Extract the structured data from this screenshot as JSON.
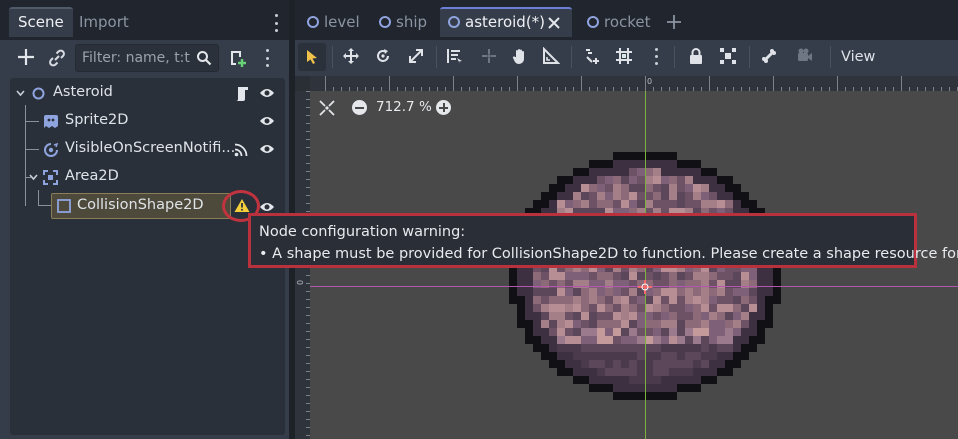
{
  "scene_dock": {
    "tabs": [
      "Scene",
      "Import"
    ],
    "filter_placeholder": "Filter: name, t:ty",
    "tree": [
      {
        "label": "Asteroid"
      },
      {
        "label": "Sprite2D"
      },
      {
        "label": "VisibleOnScreenNotifi..."
      },
      {
        "label": "Area2D"
      },
      {
        "label": "CollisionShape2D"
      }
    ]
  },
  "scene_tabs": [
    {
      "label": "level"
    },
    {
      "label": "ship"
    },
    {
      "label": "asteroid(*)"
    },
    {
      "label": "rocket"
    }
  ],
  "toolbar": {
    "view_label": "View"
  },
  "viewport": {
    "zoom_label": "712.7 %",
    "ruler_top_label": "0",
    "ruler_left_label": "0"
  },
  "warning": {
    "title": "Node configuration warning:",
    "message": "•  A shape must be provided for CollisionShape2D to function. Please create a shape resource for it!"
  },
  "colors": {
    "accent": "#6b7fd6",
    "warning_border": "#b8313c",
    "node_blue": "#8fa3df",
    "axis_x": "#b157ae",
    "axis_y": "#7ab13f"
  }
}
